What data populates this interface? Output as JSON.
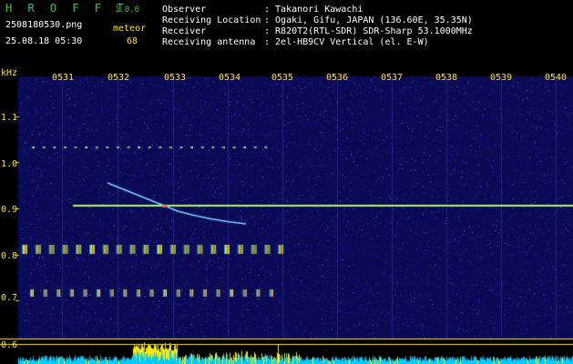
{
  "header": {
    "app_name": "H R O F F T",
    "version": "1.0.0",
    "file_name": "2508180530.png",
    "date_time": "25.08.18 05:30",
    "type_label": "meteor",
    "count": "68",
    "observer_label": "Observer",
    "observer_value": ": Takanori Kawachi",
    "location_label": "Receiving Location",
    "location_value": ": Ogaki, Gifu, JAPAN (136.60E, 35.35N)",
    "receiver_label": "Receiver",
    "receiver_value": ": R820T2(RTL-SDR) SDR-Sharp 53.1000MHz",
    "antenna_label": "Receiving antenna",
    "antenna_value": ": 2el-HB9CV Vertical (el. E-W)"
  },
  "axes": {
    "y_unit": "kHz",
    "y_ticks": [
      "1.1",
      "1.0",
      "0.9",
      "0.8",
      "0.7",
      "0.6"
    ],
    "x_ticks": [
      "0531",
      "0532",
      "0533",
      "0534",
      "0535",
      "0536",
      "0537",
      "0538",
      "0539",
      "0540"
    ]
  },
  "colors": {
    "label": "#ffe600",
    "title": "#3cc83c",
    "background": "#000000",
    "noise": "#12127a",
    "carrier": "#aaff55",
    "level": "#00ccff"
  }
}
